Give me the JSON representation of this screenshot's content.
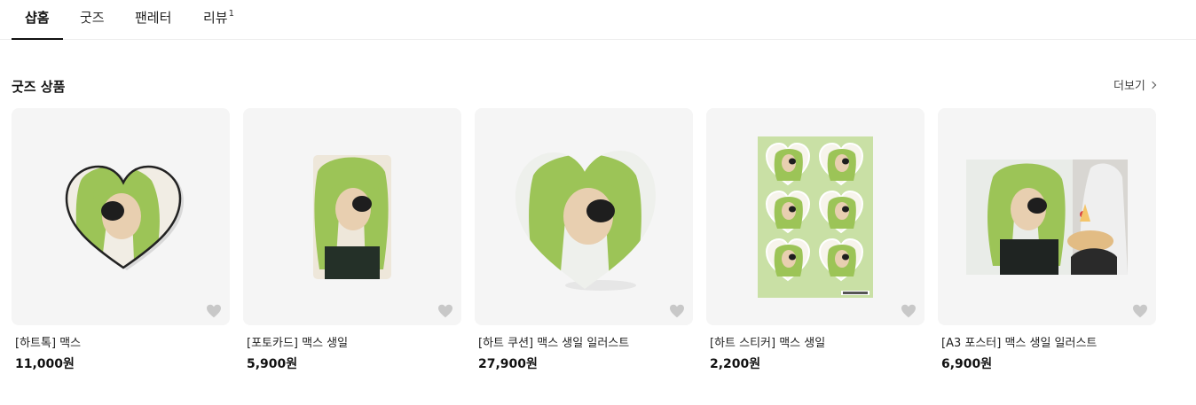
{
  "tabs": [
    {
      "label": "샵홈",
      "active": true
    },
    {
      "label": "굿즈",
      "active": false
    },
    {
      "label": "팬레터",
      "active": false
    },
    {
      "label": "리뷰",
      "count": "1",
      "active": false
    }
  ],
  "section": {
    "title": "굿즈 상품",
    "more_label": "더보기"
  },
  "products": [
    {
      "name": "[하트톡] 맥스",
      "price": "11,000원"
    },
    {
      "name": "[포토카드] 맥스 생일",
      "price": "5,900원"
    },
    {
      "name": "[하트 쿠션] 맥스 생일 일러스트",
      "price": "27,900원"
    },
    {
      "name": "[하트 스티커] 맥스 생일",
      "price": "2,200원"
    },
    {
      "name": "[A3 포스터] 맥스 생일 일러스트",
      "price": "6,900원"
    }
  ],
  "icons": {
    "like": "heart-icon",
    "more": "chevron-right-icon"
  },
  "colors": {
    "card_bg": "#f5f5f5",
    "like_icon": "#c8c8c8",
    "sticker_bg": "#c9e0a5"
  }
}
